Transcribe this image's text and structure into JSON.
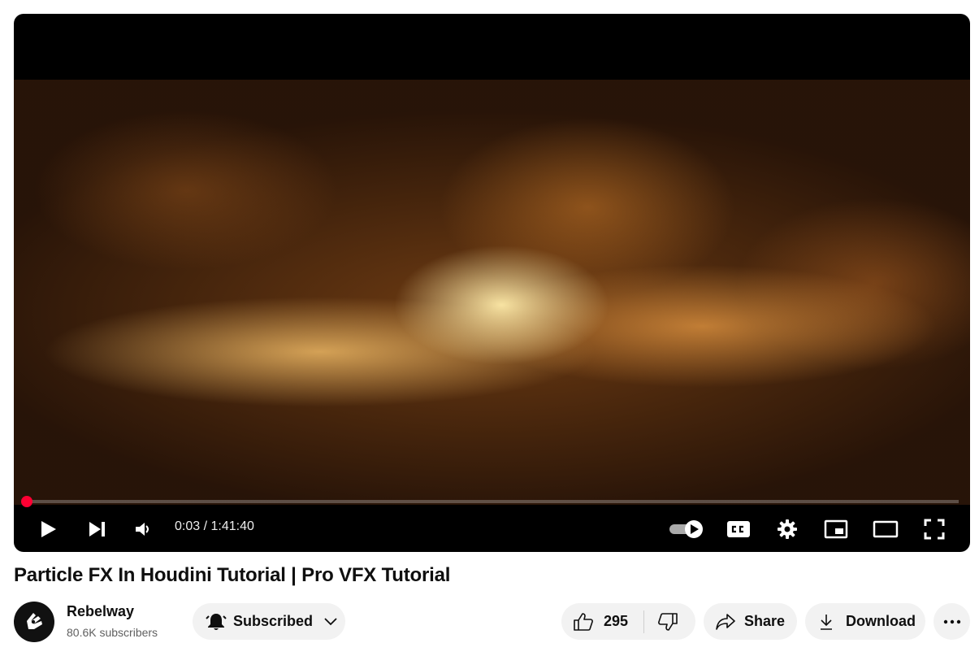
{
  "player": {
    "progress_fraction": 0.0005,
    "time_display": "0:03 / 1:41:40"
  },
  "video": {
    "title": "Particle FX In Houdini Tutorial | Pro VFX Tutorial"
  },
  "channel": {
    "name": "Rebelway",
    "subscribers": "80.6K subscribers"
  },
  "actions": {
    "subscribe_label": "Subscribed",
    "like_count": "295",
    "share_label": "Share",
    "download_label": "Download"
  },
  "colors": {
    "progress": "#ff0033",
    "pill_bg": "#f2f2f2"
  }
}
